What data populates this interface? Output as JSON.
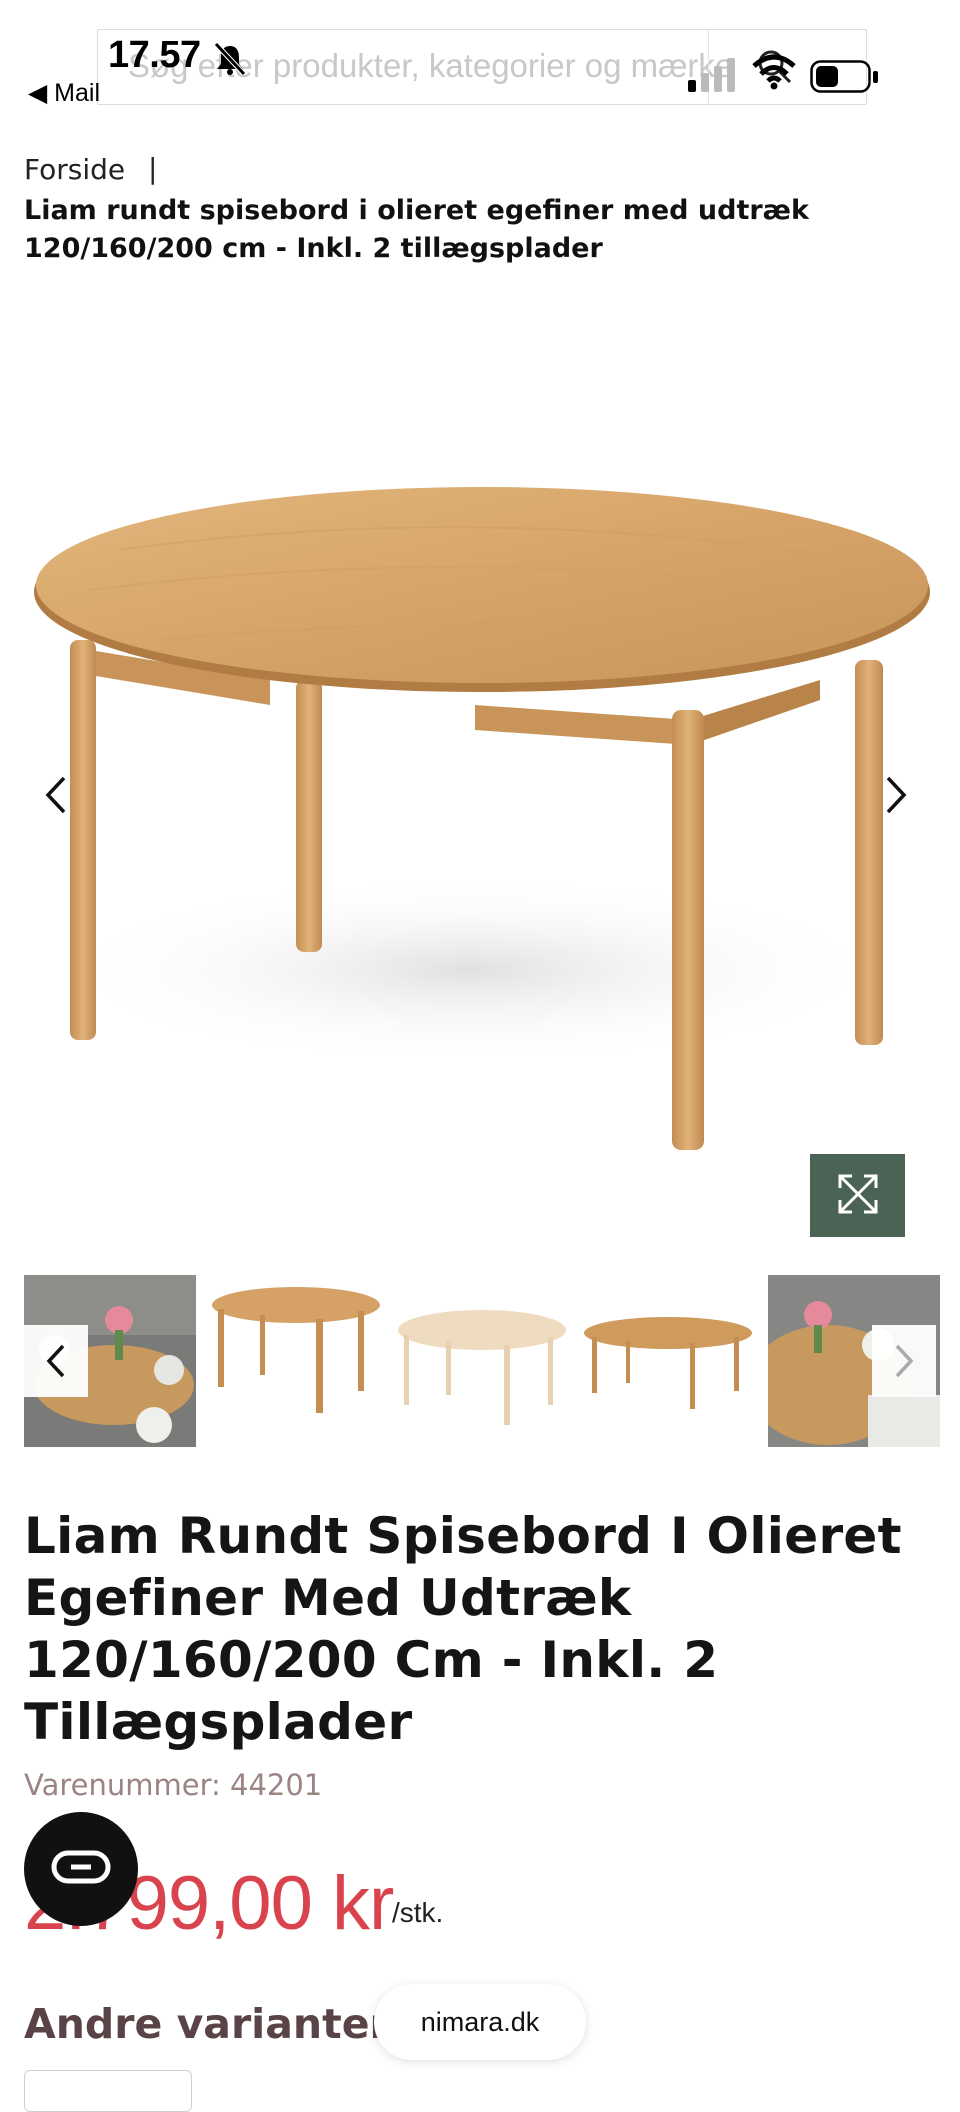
{
  "status_bar": {
    "time": "17.57",
    "back_label": "◀ Mail"
  },
  "search": {
    "placeholder": "Søg efter produkter, kategorier og mærker"
  },
  "breadcrumb": {
    "home": "Forside",
    "separator": "|",
    "current": "Liam rundt spisebord i olieret egefiner med udtræk 120/160/200 cm - Inkl. 2 tillægsplader"
  },
  "product": {
    "title": "Liam Rundt Spisebord I Olieret Egefiner Med Udtræk 120/160/200 Cm - Inkl. 2 Tillægsplader",
    "sku": "Varenummer: 44201",
    "price": "2.799,00 kr",
    "unit": "/stk."
  },
  "sections": {
    "variants_heading": "Andre varianter"
  },
  "browser": {
    "domain": "nimara.dk"
  },
  "colors": {
    "accent_price": "#d8434d",
    "zoom_button": "#4a6355",
    "heading_muted": "#5a4347",
    "wood": "#d9a96a"
  },
  "icons": {
    "gallery_prev": "chevron-left-icon",
    "gallery_next": "chevron-right-icon",
    "zoom": "expand-icon",
    "chat": "chat-icon"
  }
}
